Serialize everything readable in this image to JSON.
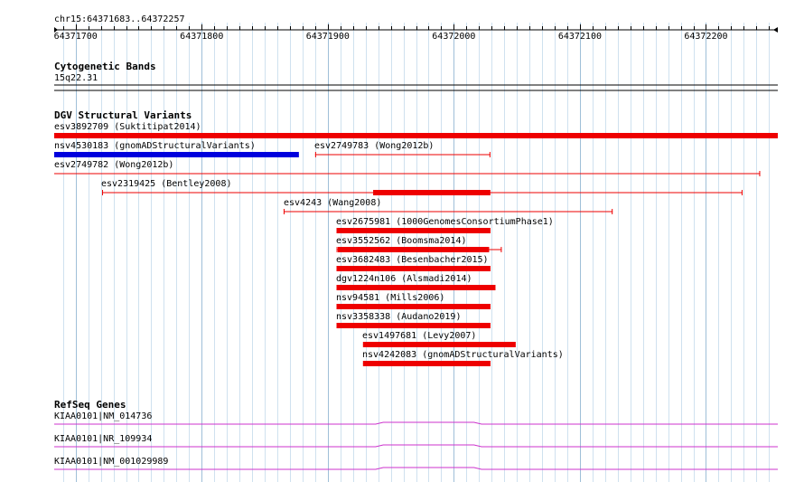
{
  "ruler": {
    "region": "chr15:64371683..64372257",
    "start": 64371683,
    "end": 64372257,
    "ticks": [
      "64371700",
      "64371800",
      "64371900",
      "64372000",
      "64372100",
      "64372200"
    ]
  },
  "cytoband": {
    "title": "Cytogenetic Bands",
    "band": "15q22.31"
  },
  "dgv": {
    "title": "DGV Structural Variants",
    "features": [
      {
        "label": "esv3892709 (Suktitipat2014)",
        "color": "#ee0000",
        "start": 64371683,
        "end": 64372257,
        "thick_start": 64371683,
        "thick_end": 64372257
      },
      {
        "label": "nsv4530183 (gnomADStructuralVariants)",
        "color": "#0000dd",
        "start": 64371683,
        "end": 64371877,
        "thick_start": 64371683,
        "thick_end": 64371877
      },
      {
        "label": "esv2749783 (Wong2012b)",
        "color": "#ee0000",
        "start": 64371890,
        "end": 64372029,
        "thick_start": null,
        "thick_end": null
      },
      {
        "label": "esv2749782 (Wong2012b)",
        "color": "#ee0000",
        "start": 64371683,
        "end": 64372243,
        "thick_start": null,
        "thick_end": null
      },
      {
        "label": "esv2319425 (Bentley2008)",
        "color": "#ee0000",
        "start": 64371721,
        "end": 64372229,
        "thick_start": 64371936,
        "thick_end": 64372029
      },
      {
        "label": "esv4243 (Wang2008)",
        "color": "#ee0000",
        "start": 64371865,
        "end": 64372126,
        "thick_start": null,
        "thick_end": null
      },
      {
        "label": "esv2675981 (1000GenomesConsortiumPhase1)",
        "color": "#ee0000",
        "start": 64371907,
        "end": 64372029,
        "thick_start": 64371907,
        "thick_end": 64372029
      },
      {
        "label": "esv3552562 (Boomsma2014)",
        "color": "#ee0000",
        "start": 64371907,
        "end": 64372038,
        "thick_start": 64371908,
        "thick_end": 64372028
      },
      {
        "label": "esv3682483 (Besenbacher2015)",
        "color": "#ee0000",
        "start": 64371907,
        "end": 64372029,
        "thick_start": 64371907,
        "thick_end": 64372029
      },
      {
        "label": "dgv1224n106 (Alsmadi2014)",
        "color": "#ee0000",
        "start": 64371907,
        "end": 64372033,
        "thick_start": 64371907,
        "thick_end": 64372033
      },
      {
        "label": "nsv94581 (Mills2006)",
        "color": "#ee0000",
        "start": 64371907,
        "end": 64372029,
        "thick_start": 64371907,
        "thick_end": 64372029
      },
      {
        "label": "nsv3358338 (Audano2019)",
        "color": "#ee0000",
        "start": 64371907,
        "end": 64372029,
        "thick_start": 64371907,
        "thick_end": 64372029
      },
      {
        "label": "esv1497681 (Levy2007)",
        "color": "#ee0000",
        "start": 64371928,
        "end": 64372049,
        "thick_start": 64371928,
        "thick_end": 64372049
      },
      {
        "label": "nsv4242083 (gnomADStructuralVariants)",
        "color": "#ee0000",
        "start": 64371928,
        "end": 64372029,
        "thick_start": 64371928,
        "thick_end": 64372029
      }
    ]
  },
  "refseq": {
    "title": "RefSeq Genes",
    "color": "#cc33cc",
    "genes": [
      {
        "label": "KIAA0101|NM_014736"
      },
      {
        "label": "KIAA0101|NR_109934"
      },
      {
        "label": "KIAA0101|NM_001029989"
      }
    ]
  }
}
